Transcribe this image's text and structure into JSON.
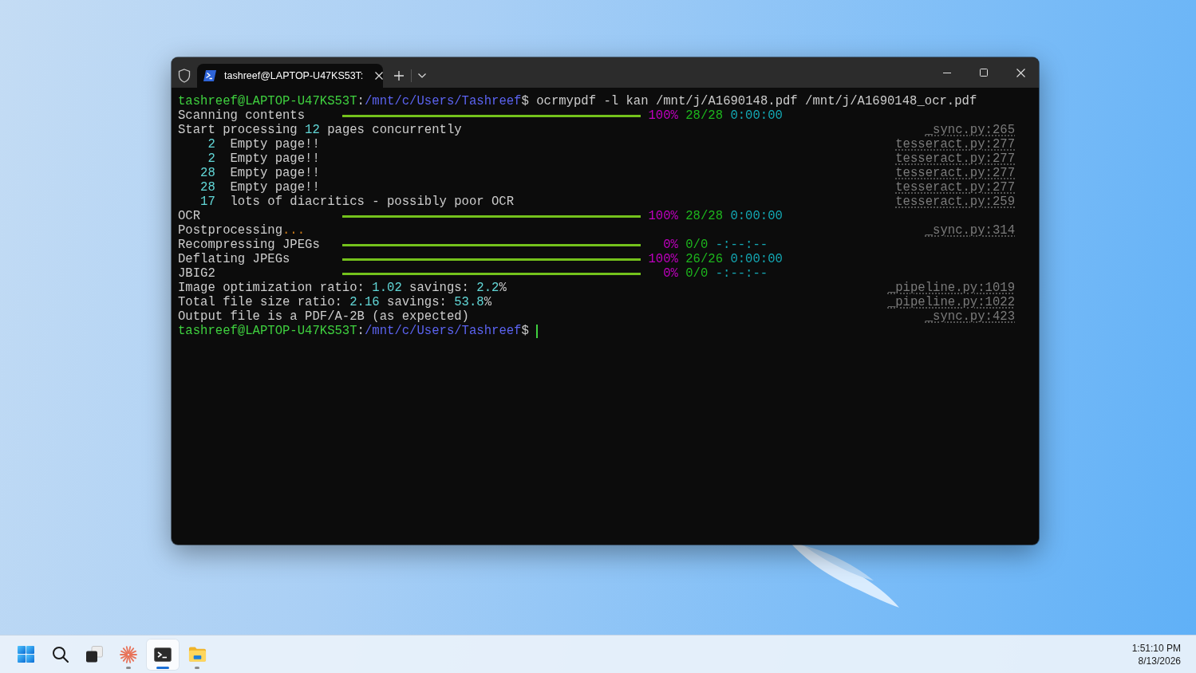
{
  "window": {
    "tabs": [
      {
        "title": "tashreef@LAPTOP-U47KS53T:",
        "selected": true
      }
    ]
  },
  "terminal": {
    "lines": [
      {
        "kind": "prompt",
        "segments": [
          {
            "kind": "user",
            "text": "tashreef@LAPTOP-U47KS53T"
          },
          {
            "kind": "plain",
            "text": ":"
          },
          {
            "kind": "path",
            "text": "/mnt/c/Users/Tashreef"
          },
          {
            "kind": "plain",
            "text": "$ ocrmypdf -l kan /mnt/j/A1690148.pdf /mnt/j/A1690148_ocr.pdf"
          }
        ],
        "cursor": false
      },
      {
        "kind": "progress",
        "label": "Scanning contents",
        "level": 1,
        "percent": "100%",
        "count": "28/28",
        "time": "0:00:00"
      },
      {
        "kind": "text",
        "segments": [
          {
            "kind": "plain",
            "text": "Start processing "
          },
          {
            "kind": "number",
            "text": "12"
          },
          {
            "kind": "plain",
            "text": " pages concurrently"
          }
        ],
        "source": "_sync.py:265"
      },
      {
        "kind": "log",
        "number": "2",
        "message": "Empty page!!",
        "source": "tesseract.py:277"
      },
      {
        "kind": "log",
        "number": "2",
        "message": "Empty page!!",
        "source": "tesseract.py:277"
      },
      {
        "kind": "log",
        "number": "28",
        "message": "Empty page!!",
        "source": "tesseract.py:277"
      },
      {
        "kind": "log",
        "number": "28",
        "message": "Empty page!!",
        "source": "tesseract.py:277"
      },
      {
        "kind": "log",
        "number": "17",
        "message": "lots of diacritics - possibly poor OCR",
        "source": "tesseract.py:259"
      },
      {
        "kind": "progress",
        "label": "OCR",
        "level": 1,
        "percent": "100%",
        "count": "28/28",
        "time": "0:00:00"
      },
      {
        "kind": "text",
        "segments": [
          {
            "kind": "plain",
            "text": "Postprocessing"
          },
          {
            "kind": "dots",
            "text": "..."
          }
        ],
        "source": "_sync.py:314"
      },
      {
        "kind": "progress",
        "label": "Recompressing JPEGs",
        "level": 1,
        "percent": "0%",
        "count": "0/0",
        "time": "-:--:--"
      },
      {
        "kind": "progress",
        "label": "Deflating JPEGs",
        "level": 1,
        "percent": "100%",
        "count": "26/26",
        "time": "0:00:00"
      },
      {
        "kind": "progress",
        "label": "JBIG2",
        "level": 1,
        "percent": "0%",
        "count": "0/0",
        "time": "-:--:--"
      },
      {
        "kind": "text",
        "segments": [
          {
            "kind": "plain",
            "text": "Image optimization ratio: "
          },
          {
            "kind": "number",
            "text": "1.02"
          },
          {
            "kind": "plain",
            "text": " savings: "
          },
          {
            "kind": "number",
            "text": "2.2"
          },
          {
            "kind": "plain",
            "text": "%"
          }
        ],
        "source": "_pipeline.py:1019"
      },
      {
        "kind": "text",
        "segments": [
          {
            "kind": "plain",
            "text": "Total file size ratio: "
          },
          {
            "kind": "number",
            "text": "2.16"
          },
          {
            "kind": "plain",
            "text": " savings: "
          },
          {
            "kind": "number",
            "text": "53.8"
          },
          {
            "kind": "plain",
            "text": "%"
          }
        ],
        "source": "_pipeline.py:1022"
      },
      {
        "kind": "text",
        "segments": [
          {
            "kind": "plain",
            "text": "Output file is a PDF/A-2B (as expected)"
          }
        ],
        "source": "_sync.py:423"
      },
      {
        "kind": "prompt",
        "segments": [
          {
            "kind": "user",
            "text": "tashreef@LAPTOP-U47KS53T"
          },
          {
            "kind": "plain",
            "text": ":"
          },
          {
            "kind": "path",
            "text": "/mnt/c/Users/Tashreef"
          },
          {
            "kind": "plain",
            "text": "$"
          }
        ],
        "cursor": true
      }
    ]
  },
  "taskbar": {
    "items": [
      {
        "kind": "start",
        "running": false,
        "selected": false
      },
      {
        "kind": "search",
        "running": false,
        "selected": false
      },
      {
        "kind": "task-view",
        "running": false,
        "selected": false
      },
      {
        "kind": "starburst",
        "running": true,
        "selected": false
      },
      {
        "kind": "terminal",
        "running": true,
        "selected": true
      },
      {
        "kind": "folder",
        "running": true,
        "selected": false
      }
    ],
    "clock": {
      "time": "1:51:10 PM",
      "date": "8/13/2026"
    }
  }
}
